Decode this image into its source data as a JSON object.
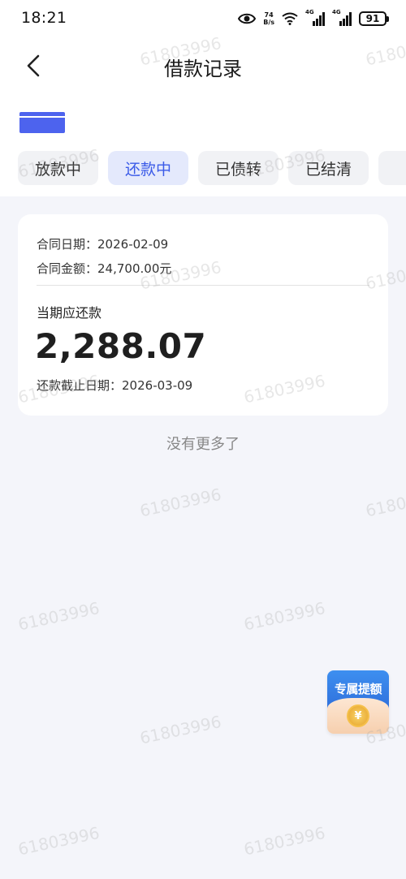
{
  "status_bar": {
    "time": "18:21",
    "net_speed_value": "74",
    "net_speed_unit": "B/s",
    "signal1_label": "4G",
    "signal2_label": "4G",
    "battery": "91",
    "icons": [
      "eye-icon",
      "wifi-icon",
      "signal-icon",
      "battery-icon"
    ]
  },
  "header": {
    "title": "借款记录",
    "back_icon": "chevron-left-icon"
  },
  "tabs": [
    {
      "label": "放款中",
      "active": false
    },
    {
      "label": "还款中",
      "active": true
    },
    {
      "label": "已债转",
      "active": false
    },
    {
      "label": "已结清",
      "active": false
    }
  ],
  "record": {
    "contract_date_label": "合同日期：",
    "contract_date": "2026-02-09",
    "contract_amount_label": "合同金额：",
    "contract_amount": "24,700.00元",
    "due_label": "当期应还款",
    "due_amount": "2,288.07",
    "deadline_label": "还款截止日期：",
    "deadline": "2026-03-09"
  },
  "footer_note": "没有更多了",
  "float_badge": {
    "label": "专属提额",
    "coin_symbol": "¥"
  },
  "watermark_text": "61803996",
  "colors": {
    "accent": "#3b5be8",
    "active_tab_bg": "#e4e9fc",
    "page_bg": "#f4f5fa"
  }
}
